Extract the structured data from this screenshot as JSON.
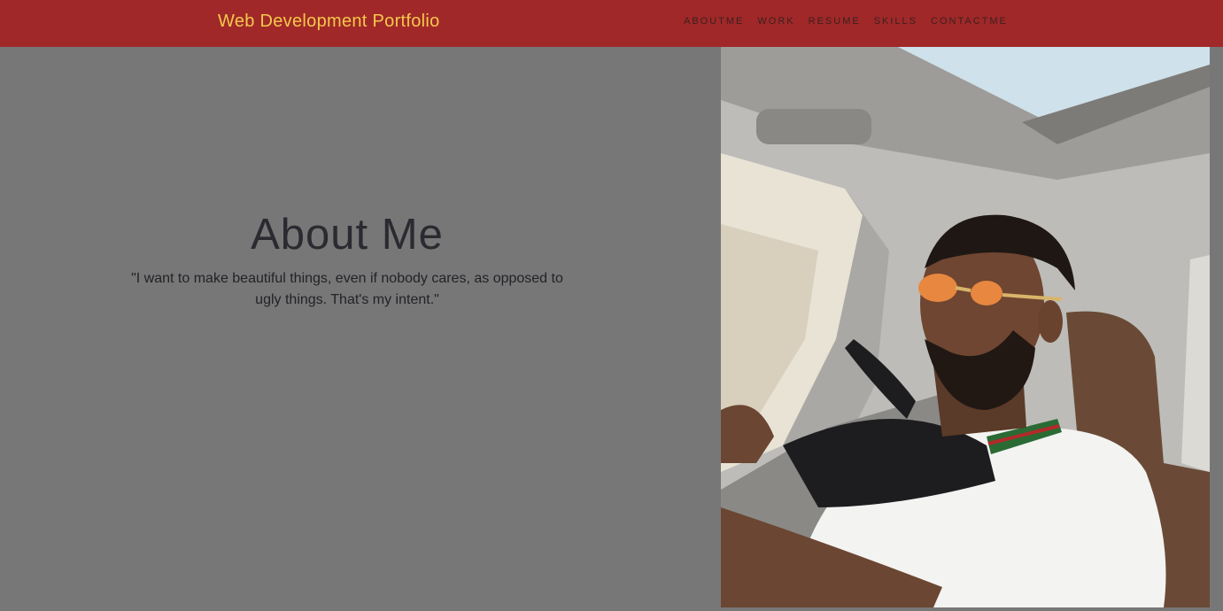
{
  "header": {
    "brand": "Web Development Portfolio",
    "nav": [
      {
        "label": "ABOUTME"
      },
      {
        "label": "WORK"
      },
      {
        "label": "RESUME"
      },
      {
        "label": "SKILLS"
      },
      {
        "label": "CONTACTME"
      }
    ]
  },
  "about": {
    "title": "About Me",
    "quote": "\"I want to make beautiful things, even if nobody cares, as opposed to ugly things. That's my intent.\""
  },
  "colors": {
    "navbar": "#a12828",
    "brand": "#f2c94c",
    "background": "#777777"
  }
}
